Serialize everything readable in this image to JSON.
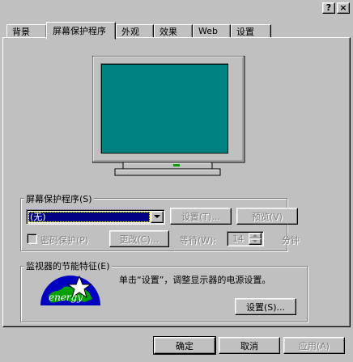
{
  "window": {
    "help_label": "?",
    "close_label": "×"
  },
  "tabs": [
    {
      "label": "背景"
    },
    {
      "label": "屏幕保护程序"
    },
    {
      "label": "外观"
    },
    {
      "label": "效果"
    },
    {
      "label": "Web"
    },
    {
      "label": "设置"
    }
  ],
  "active_tab": 1,
  "screensaver": {
    "group_label": "屏幕保护程序(S)",
    "selected": "(无)",
    "settings_button": "设置(T)...",
    "preview_button": "预览(V)",
    "password_checkbox": "密码保护(P)",
    "password_checked": false,
    "change_button": "更改(C)...",
    "wait_label": "等待(W):",
    "wait_value": "14",
    "minutes_label": "分钟"
  },
  "energy": {
    "group_label": "监视器的节能特征(E)",
    "description": "单击“设置”，调整显示器的电源设置。",
    "settings_button": "设置(S)...",
    "logo_text": "energy"
  },
  "footer": {
    "ok": "确定",
    "cancel": "取消",
    "apply": "应用(A)"
  },
  "colors": {
    "screen": "#008080",
    "face": "#c0c0c0",
    "selection": "#000080"
  }
}
